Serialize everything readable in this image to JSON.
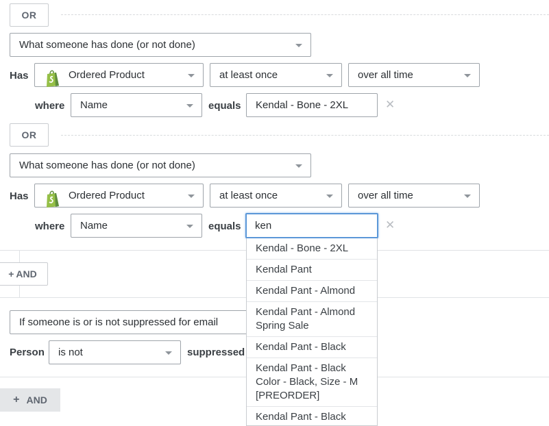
{
  "condition_group": {
    "or_label": "OR",
    "blocks": [
      {
        "type_select": "What someone has done (or not done)",
        "has_label": "Has",
        "metric_select": "Ordered Product",
        "frequency_select": "at least once",
        "timeframe_select": "over all time",
        "where_label": "where",
        "property_select": "Name",
        "operator_label": "equals",
        "value": "Kendal - Bone - 2XL"
      },
      {
        "type_select": "What someone has done (or not done)",
        "has_label": "Has",
        "metric_select": "Ordered Product",
        "frequency_select": "at least once",
        "timeframe_select": "over all time",
        "where_label": "where",
        "property_select": "Name",
        "operator_label": "equals",
        "value": "ken"
      }
    ],
    "and_button": "AND"
  },
  "suppression": {
    "type_select": "If someone is or is not suppressed for email",
    "person_label": "Person",
    "status_select": "is not",
    "suppressed_label": "suppressed"
  },
  "footer": {
    "and_button": "AND"
  },
  "autocomplete": {
    "options": [
      "Kendal - Bone - 2XL",
      "Kendal Pant",
      "Kendal Pant - Almond",
      "Kendal Pant - Almond Spring Sale",
      "Kendal Pant - Black",
      "Kendal Pant - Black Color - Black, Size - M [PREORDER]",
      "Kendal Pant - Black Spring Sale"
    ]
  },
  "colors": {
    "shopify_green": "#95bf47",
    "focus_blue": "#5b97d8",
    "footer_gray": "#e4e6e8"
  },
  "icons": {
    "remove": "✕",
    "plus": "+",
    "caret": "caret-down"
  }
}
